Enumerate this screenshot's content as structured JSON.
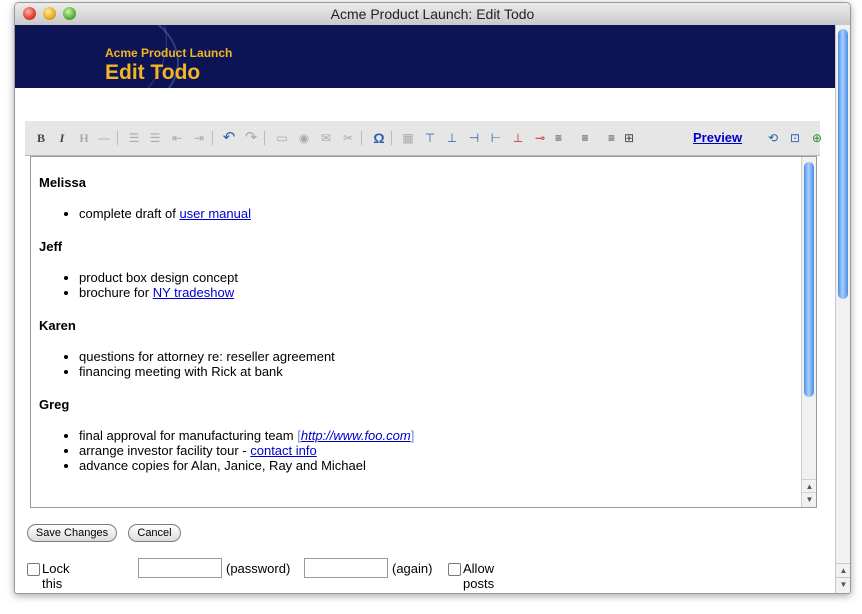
{
  "window": {
    "title": "Acme Product Launch: Edit Todo"
  },
  "banner": {
    "project": "Acme Product Launch",
    "page_title": "Edit Todo"
  },
  "toolbar": {
    "preview_label": "Preview",
    "buttons": [
      "bold-icon",
      "italic-icon",
      "heading-icon",
      "horizontal-rule-icon",
      "bullet-list-icon",
      "numbered-list-icon",
      "outdent-icon",
      "indent-icon",
      "undo-icon",
      "redo-icon",
      "insert-image-icon",
      "insert-media-icon",
      "insert-email-icon",
      "unlink-icon",
      "special-character-icon",
      "insert-table-icon",
      "insert-row-before-icon",
      "insert-row-after-icon",
      "insert-column-before-icon",
      "insert-column-after-icon",
      "delete-column-icon",
      "delete-row-icon",
      "align-left-icon",
      "align-center-icon",
      "align-right-icon",
      "show-borders-icon"
    ],
    "glyphs": {
      "bold": "B",
      "italic": "I",
      "heading": "H",
      "hr": "—",
      "ul": "☰",
      "ol": "☰",
      "outdent": "⇤",
      "indent": "⇥",
      "undo": "↶",
      "redo": "↷",
      "image": "▭",
      "media": "◉",
      "email": "✉",
      "unlink": "✂",
      "omega": "Ω",
      "table": "▦",
      "row_before": "⊤",
      "row_after": "⊥",
      "col_before": "⊣",
      "col_after": "⊢",
      "del_col": "⊥",
      "del_row": "⊸",
      "align_left": "≡",
      "align_center": "≡",
      "align_right": "≡",
      "borders": "⊞",
      "edit_source": "⟲",
      "fullscreen": "⊡",
      "add": "⊕"
    }
  },
  "editor": {
    "sections": [
      {
        "name": "Melissa",
        "items": [
          {
            "text": "complete draft of ",
            "link": "user manual"
          }
        ]
      },
      {
        "name": "Jeff",
        "items": [
          {
            "text": "product box design concept"
          },
          {
            "text": "brochure for ",
            "link": "NY tradeshow"
          }
        ]
      },
      {
        "name": "Karen",
        "items": [
          {
            "text": "questions for attorney re: reseller agreement"
          },
          {
            "text": "financing meeting with Rick at bank"
          }
        ]
      },
      {
        "name": "Greg",
        "items": [
          {
            "text": "final approval for manufacturing team ",
            "ext_open": "[",
            "ext_link": "http://www.foo.com",
            "ext_close": "]"
          },
          {
            "text": "arrange investor facility tour - ",
            "link": "contact info"
          },
          {
            "text": "advance copies for Alan, Janice, Ray and Michael"
          }
        ]
      }
    ]
  },
  "actions": {
    "save_label": "Save Changes",
    "cancel_label": "Cancel"
  },
  "lock": {
    "lock_label": "Lock this page:",
    "password_label": "(password)",
    "again_label": "(again)",
    "allow_label": "Allow posts when locked",
    "password_value": "",
    "again_value": ""
  },
  "scroll": {
    "up_glyph": "▲",
    "down_glyph": "▼"
  },
  "colors": {
    "banner": "#0c1455",
    "banner_text": "#f2b523",
    "link": "#0000cc",
    "ext_link": "#6e88d8",
    "scroll_thumb": "#4b8ee6"
  }
}
